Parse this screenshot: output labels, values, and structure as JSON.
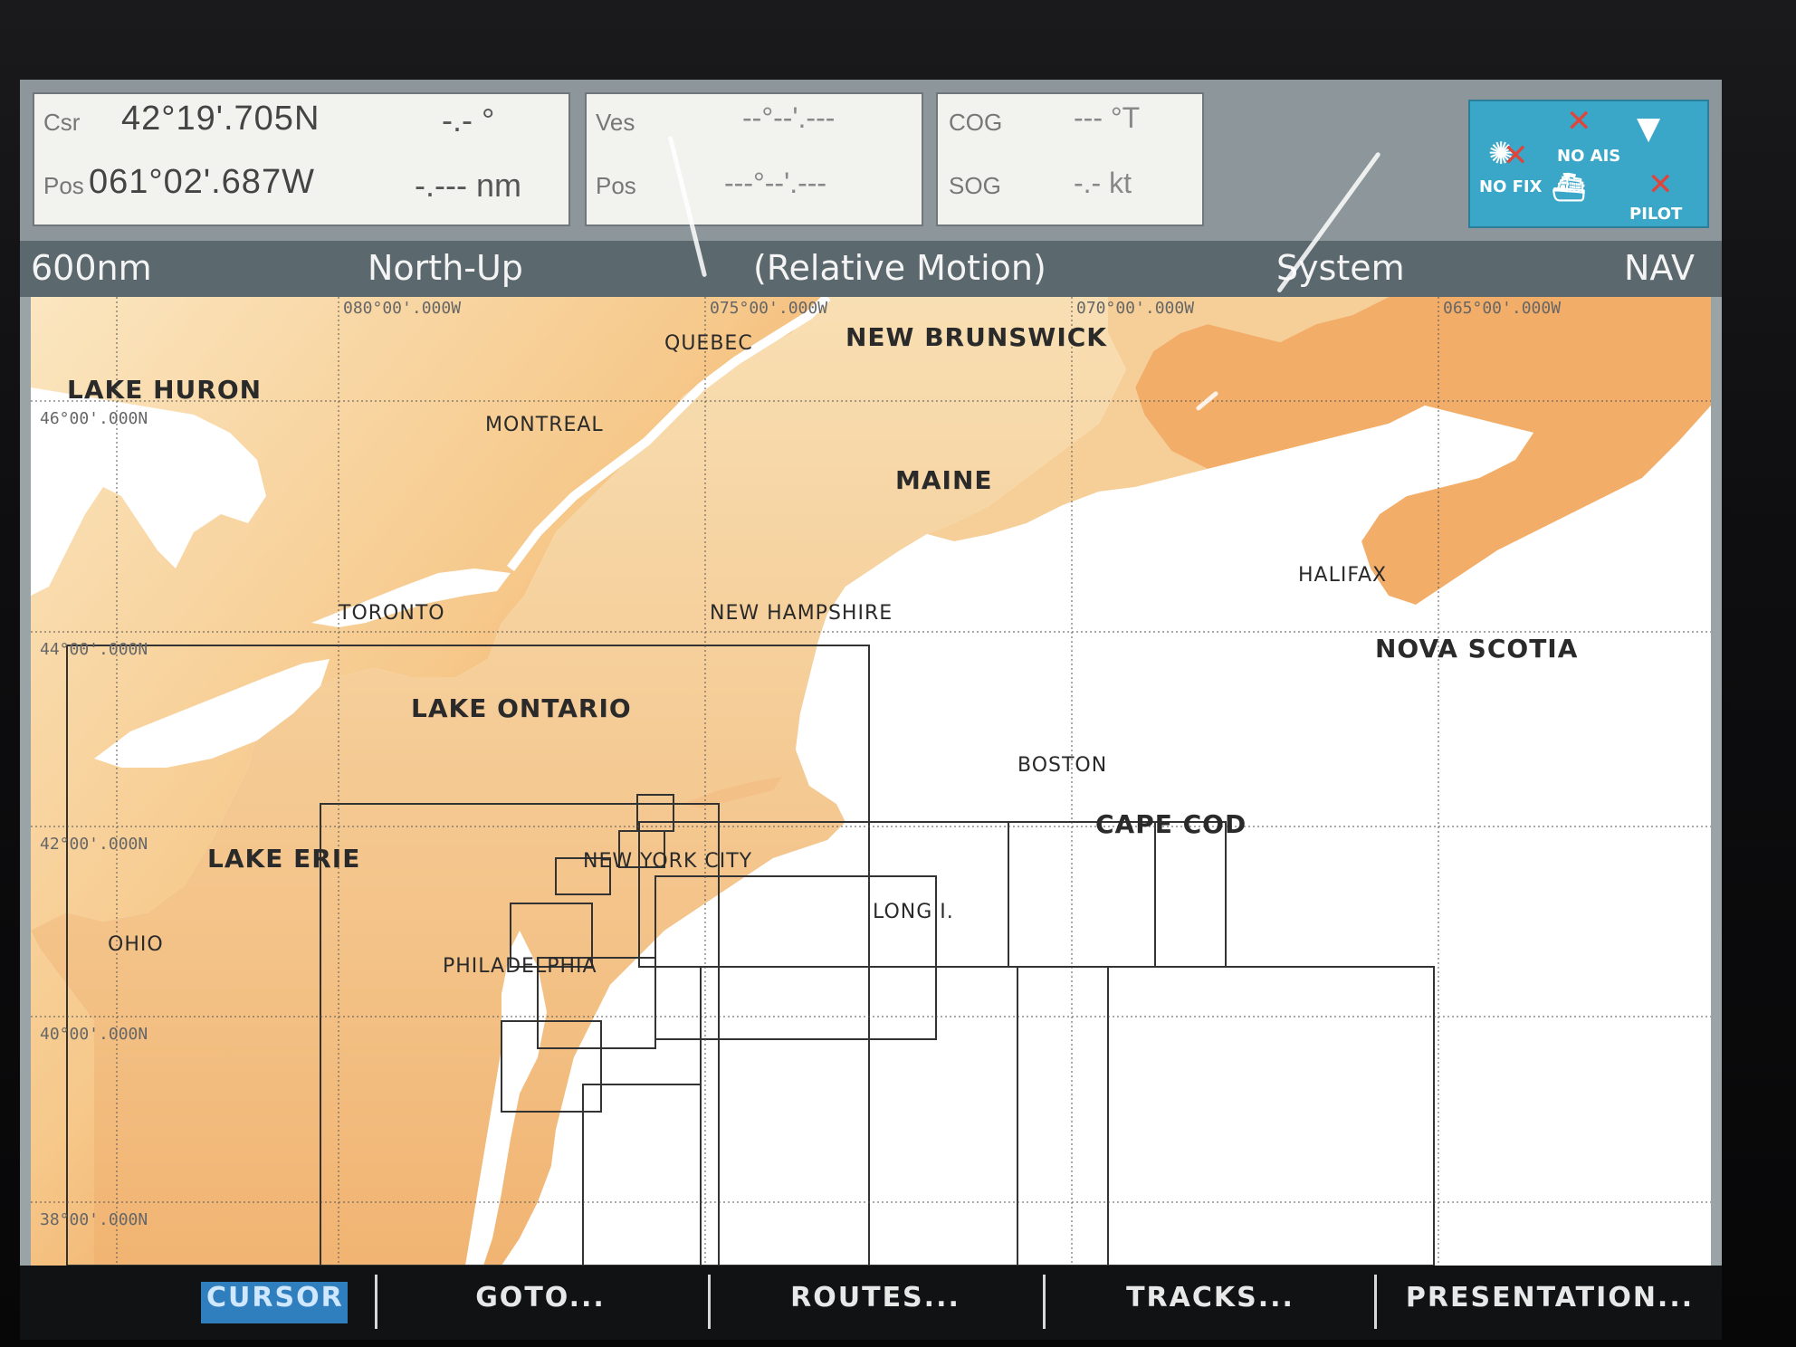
{
  "databar": {
    "csr_label": "Csr",
    "csr_lat": "42°19'.705N",
    "csr_bearing": "-.- °",
    "pos_label": "Pos",
    "csr_lon": "061°02'.687W",
    "csr_range": "-.--- nm",
    "ves_label": "Ves",
    "ves_lat": "--°--'.---",
    "ves_pos_label": "Pos",
    "ves_lon": "---°--'.---",
    "cog_label": "COG",
    "cog_value": "--- °T",
    "sog_label": "SOG",
    "sog_value": "-.- kt"
  },
  "status": {
    "no_fix": "NO FIX",
    "no_ais": "NO AIS",
    "pilot": "PILOT"
  },
  "header": {
    "range": "600nm",
    "orientation": "North-Up",
    "motion": "(Relative Motion)",
    "datum": "System",
    "mode": "NAV"
  },
  "grid_labels": {
    "lon_080": "080°00'.000W",
    "lon_075": "075°00'.000W",
    "lon_070": "070°00'.000W",
    "lon_065": "065°00'.000W",
    "lat_46": "46°00'.000N",
    "lat_44": "44°00'.000N",
    "lat_42": "42°00'.000N",
    "lat_40": "40°00'.000N",
    "lat_38": "38°00'.000N"
  },
  "places": {
    "quebec": "QUEBEC",
    "new_brunswick": "NEW BRUNSWICK",
    "lake_huron": "LAKE HURON",
    "montreal": "MONTREAL",
    "maine": "MAINE",
    "halifax": "HALIFAX",
    "toronto": "TORONTO",
    "new_hampshire": "NEW HAMPSHIRE",
    "nova_scotia": "NOVA SCOTIA",
    "lake_ontario": "LAKE ONTARIO",
    "boston": "BOSTON",
    "cape_cod": "CAPE COD",
    "lake_erie": "LAKE ERIE",
    "new_york_city": "NEW YORK CITY",
    "long_island": "LONG I.",
    "ohio": "OHIO",
    "philadelphia": "PHILADELPHIA"
  },
  "softkeys": {
    "cursor": "CURSOR",
    "goto": "GOTO...",
    "routes": "ROUTES...",
    "tracks": "TRACKS...",
    "presentation": "PRESENTATION..."
  },
  "colors": {
    "land_light": "#f7dcae",
    "land_dark": "#ea8f3a",
    "water": "#ffffff",
    "header_bg": "#5b686e",
    "status_panel": "#3aa7c9",
    "active_softkey": "#2f7fbf"
  }
}
